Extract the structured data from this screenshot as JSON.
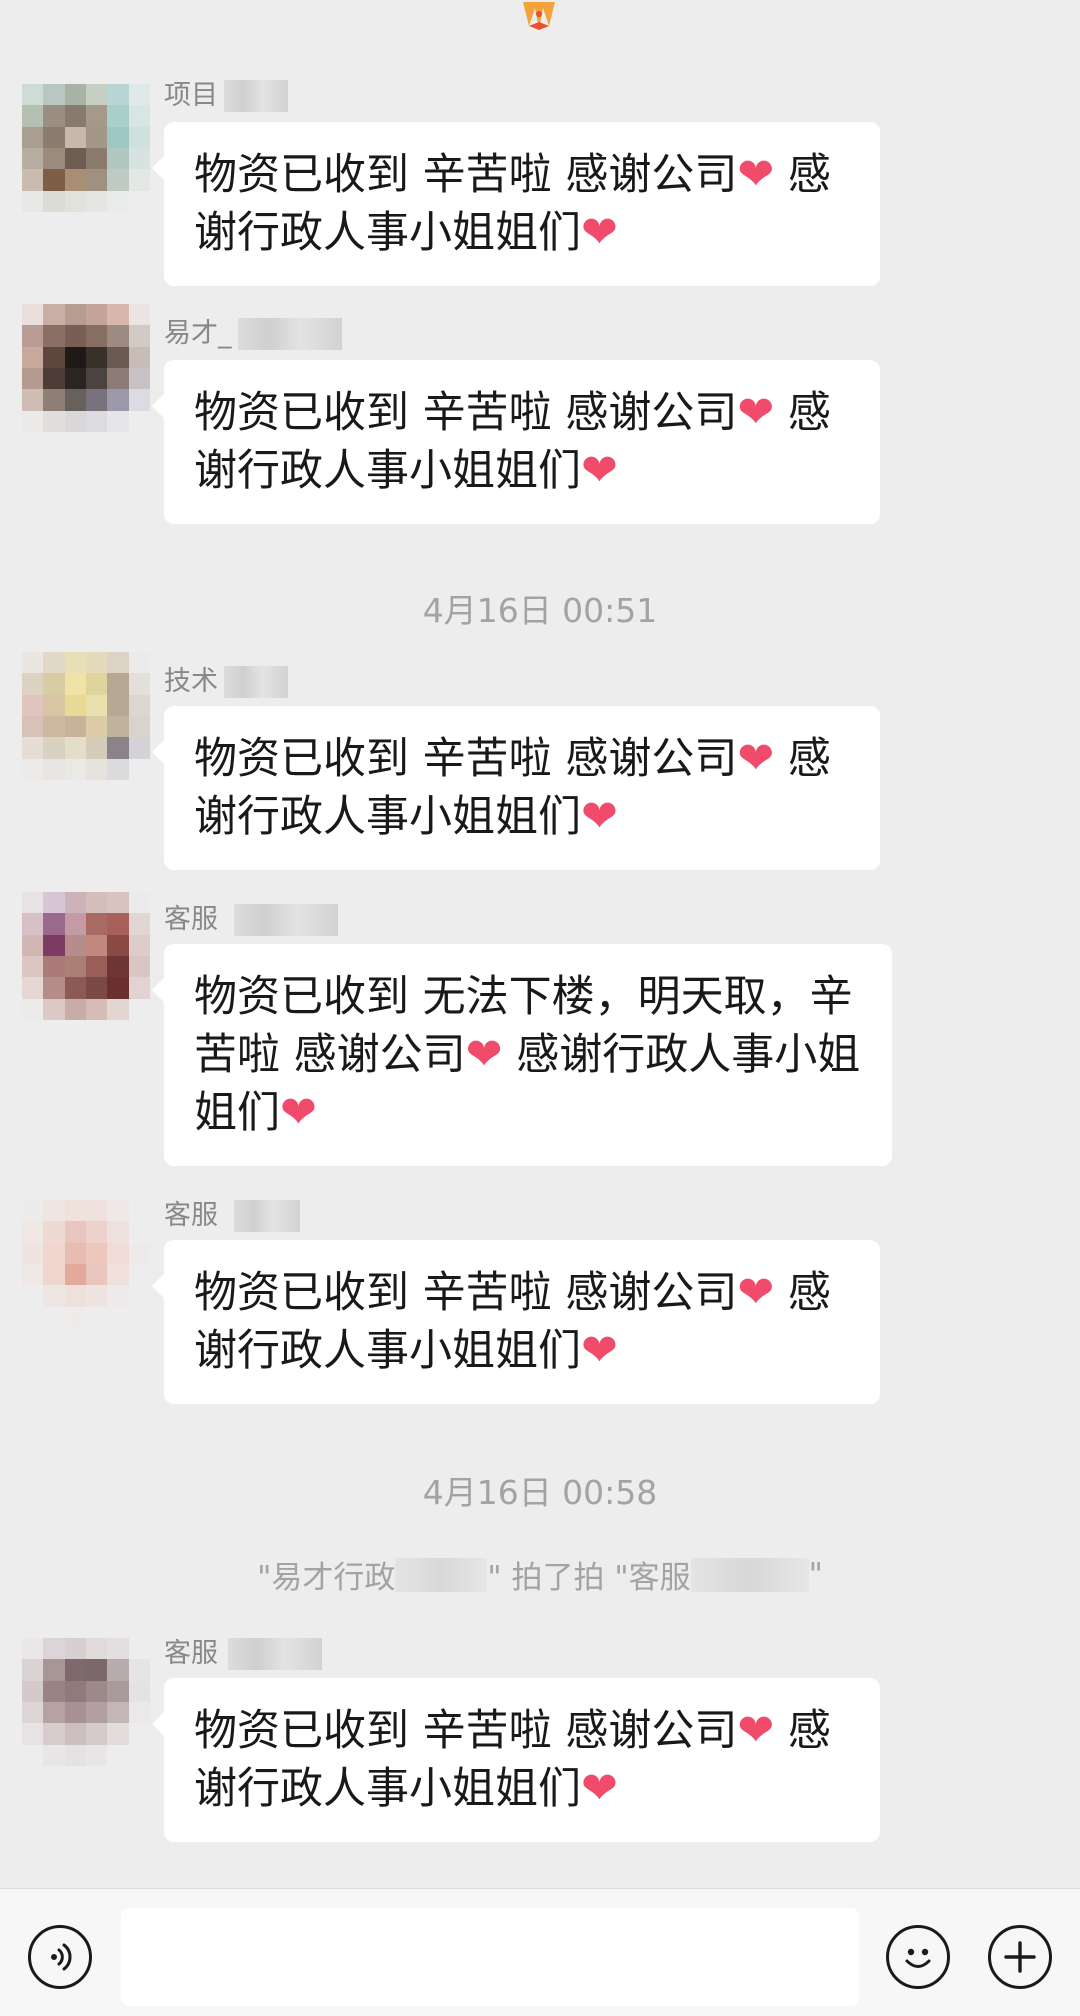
{
  "messages": [
    {
      "sender": "项目",
      "text": "物资已收到 辛苦啦 感谢公司❤ 感谢行政人事小姐姐们❤"
    },
    {
      "sender": "易才_",
      "text": "物资已收到 辛苦啦 感谢公司❤ 感谢行政人事小姐姐们❤"
    },
    {
      "sender": "技术",
      "text": "物资已收到 辛苦啦 感谢公司❤ 感谢行政人事小姐姐们❤"
    },
    {
      "sender": "客服",
      "text": "物资已收到 无法下楼，明天取，辛苦啦 感谢公司❤ 感谢行政人事小姐姐们❤"
    },
    {
      "sender": "客服",
      "text": "物资已收到 辛苦啦 感谢公司❤ 感谢行政人事小姐姐们❤"
    },
    {
      "sender": "客服",
      "text": "物资已收到 辛苦啦 感谢公司❤ 感谢行政人事小姐姐们❤"
    }
  ],
  "timestamps": [
    "4月16日 00:51",
    "4月16日 00:58"
  ],
  "system_notice": {
    "part1": "\"易才行政",
    "part2": "\" 拍了拍 \"客服",
    "part3": "\""
  },
  "input_bar": {
    "voice_icon": "voice-icon",
    "emoji_icon": "emoji-icon",
    "plus_icon": "plus-icon"
  }
}
